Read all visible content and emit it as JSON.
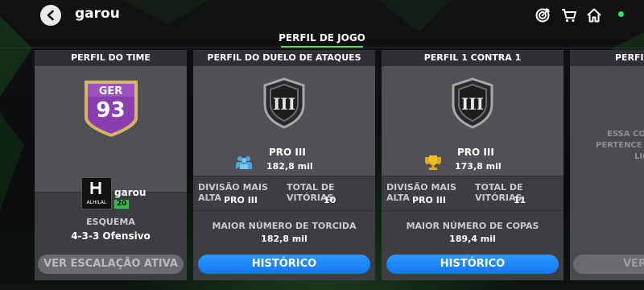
{
  "header": {
    "username": "garou",
    "icons": [
      "back-icon",
      "target-icon",
      "cart-icon",
      "home-icon",
      "online-status-dot"
    ]
  },
  "tab": {
    "label": "PERFIL DE JOGO"
  },
  "team_card": {
    "title": "PERFIL DO TIME",
    "ovr_label": "GER",
    "ovr_value": "93",
    "club_name": "garou",
    "club_logo_text": "ALHILAL",
    "level_badge": "20",
    "scheme_label": "ESQUEMA",
    "scheme_value": "4-3-3 Ofensivo",
    "button": "VER ESCALAÇÃO ATIVA"
  },
  "attack_card": {
    "title": "PERFIL DO DUELO DE ATAQUES",
    "rank_numeral": "III",
    "division": "PRO III",
    "points": "182,8 mil",
    "highest_label": "DIVISÃO MAIS ALTA",
    "highest_value": "PRO III",
    "wins_label": "TOTAL DE VITÓRIAS",
    "wins_value": "10",
    "record_label": "MAIOR NÚMERO DE TORCIDA",
    "record_value": "182,8 mil",
    "button": "HISTÓRICO"
  },
  "h2h_card": {
    "title": "PERFIL 1 CONTRA 1",
    "rank_numeral": "III",
    "division": "PRO III",
    "points": "173,8 mil",
    "highest_label": "DIVISÃO MAIS ALTA",
    "highest_value": "PRO III",
    "wins_label": "TOTAL DE VITÓRIAS",
    "wins_value": "11",
    "record_label": "MAIOR NÚMERO DE COPAS",
    "record_value": "189,4 mil",
    "button": "HISTÓRICO"
  },
  "partial_card": {
    "title": "PERFIL",
    "line1": "ESSA CO",
    "line2": "PERTENCE À",
    "line3": "LIG",
    "button": "VER"
  },
  "colors": {
    "accent_green": "#3fe06a",
    "button_blue": "#1f8bff",
    "ovr_purple": "#8a3fb0",
    "gold": "#d8b563"
  }
}
